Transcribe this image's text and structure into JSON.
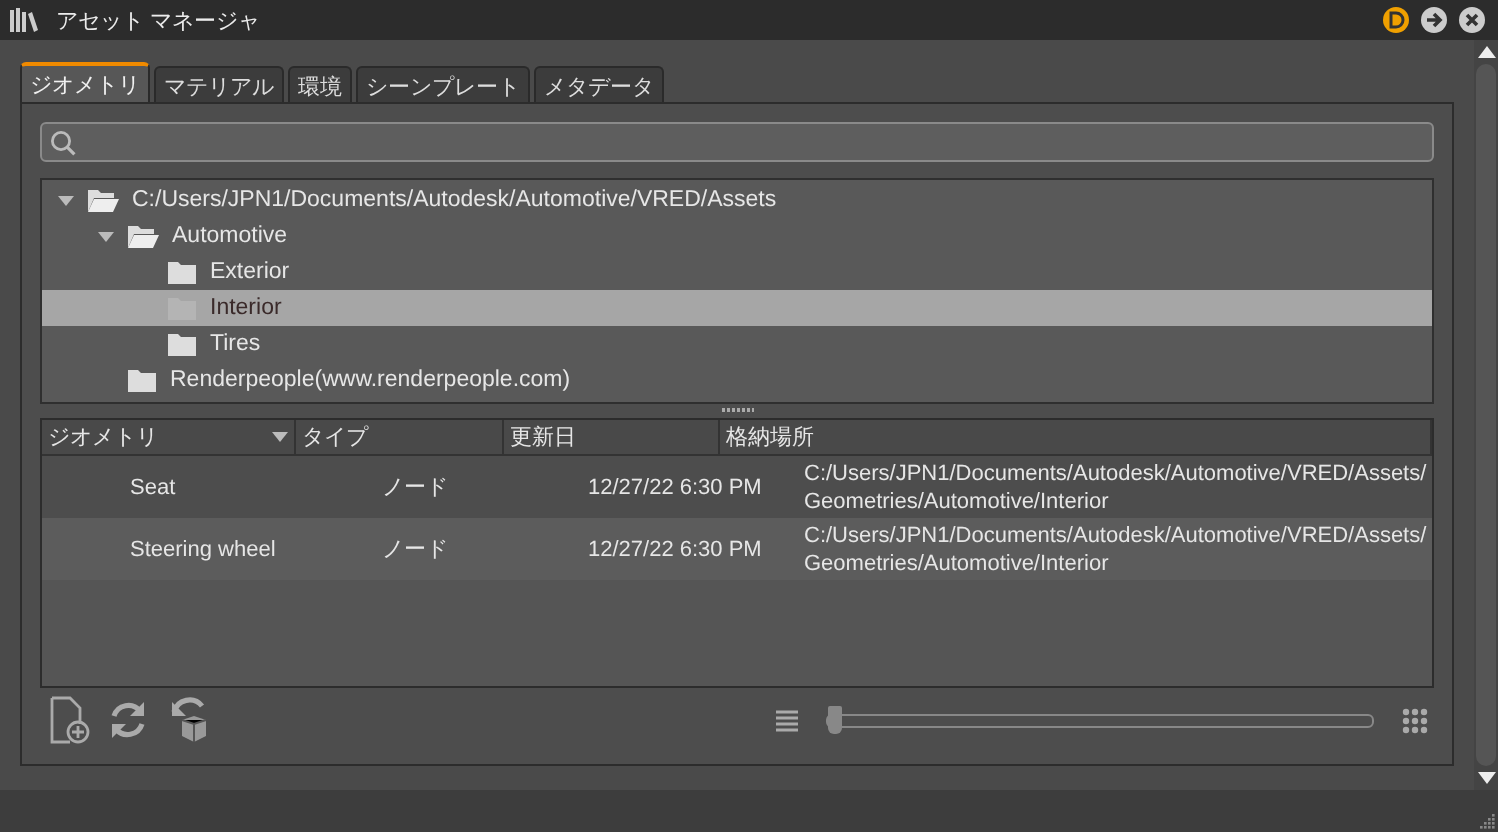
{
  "window": {
    "title": "アセット マネージャ"
  },
  "tabs": [
    {
      "label": "ジオメトリ",
      "selected": true
    },
    {
      "label": "マテリアル",
      "selected": false
    },
    {
      "label": "環境",
      "selected": false
    },
    {
      "label": "シーンプレート",
      "selected": false
    },
    {
      "label": "メタデータ",
      "selected": false
    }
  ],
  "tree": [
    {
      "label": "C:/Users/JPN1/Documents/Autodesk/Automotive/VRED/Assets",
      "expanded": true,
      "selected": false,
      "children": [
        {
          "label": "Automotive",
          "expanded": true,
          "selected": false,
          "children": [
            {
              "label": "Exterior",
              "selected": false
            },
            {
              "label": "Interior",
              "selected": true
            },
            {
              "label": "Tires",
              "selected": false
            }
          ]
        },
        {
          "label": "Renderpeople(www.renderpeople.com)",
          "selected": false
        }
      ]
    }
  ],
  "table": {
    "columns": [
      "ジオメトリ",
      "タイプ",
      "更新日",
      "格納場所"
    ],
    "rows": [
      {
        "name": "Seat",
        "type": "ノード",
        "date": "12/27/22 6:30 PM",
        "location": "C:/Users/JPN1/Documents/Autodesk/Automotive/VRED/Assets/ Geometries/Automotive/Interior"
      },
      {
        "name": "Steering wheel",
        "type": "ノード",
        "date": "12/27/22 6:30 PM",
        "location": "C:/Users/JPN1/Documents/Autodesk/Automotive/VRED/Assets/ Geometries/Automotive/Interior"
      }
    ]
  },
  "size_slider": {
    "level": 0.0
  }
}
